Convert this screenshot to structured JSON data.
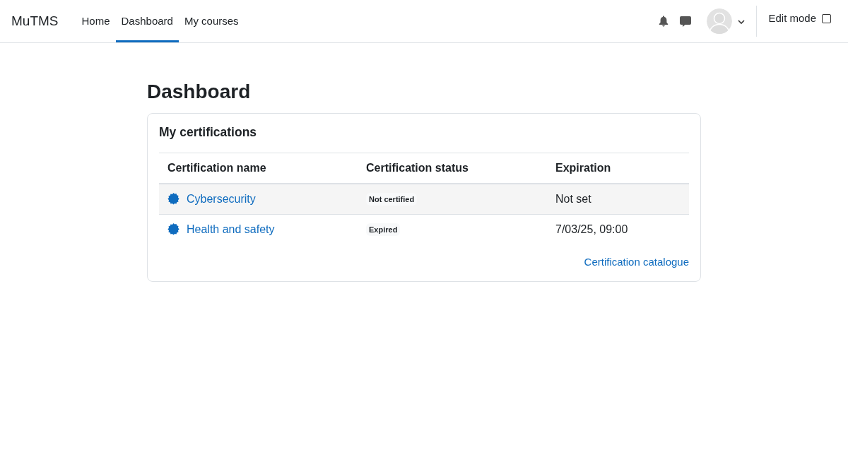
{
  "navbar": {
    "brand": "MuTMS",
    "nav_items": [
      {
        "label": "Home",
        "selected": false
      },
      {
        "label": "Dashboard",
        "selected": true
      },
      {
        "label": "My courses",
        "selected": false
      }
    ],
    "edit_mode": {
      "label": "Edit mode",
      "checked": false
    }
  },
  "page": {
    "title": "Dashboard"
  },
  "block": {
    "title": "My certifications",
    "table": {
      "columns": [
        "Certification name",
        "Certification status",
        "Expiration"
      ],
      "rows": [
        {
          "name": "Cybersecurity",
          "status": "Not certified",
          "expiration": "Not set"
        },
        {
          "name": "Health and safety",
          "status": "Expired",
          "expiration": "7/03/25, 09:00"
        }
      ]
    },
    "footer_link": "Certification catalogue"
  }
}
